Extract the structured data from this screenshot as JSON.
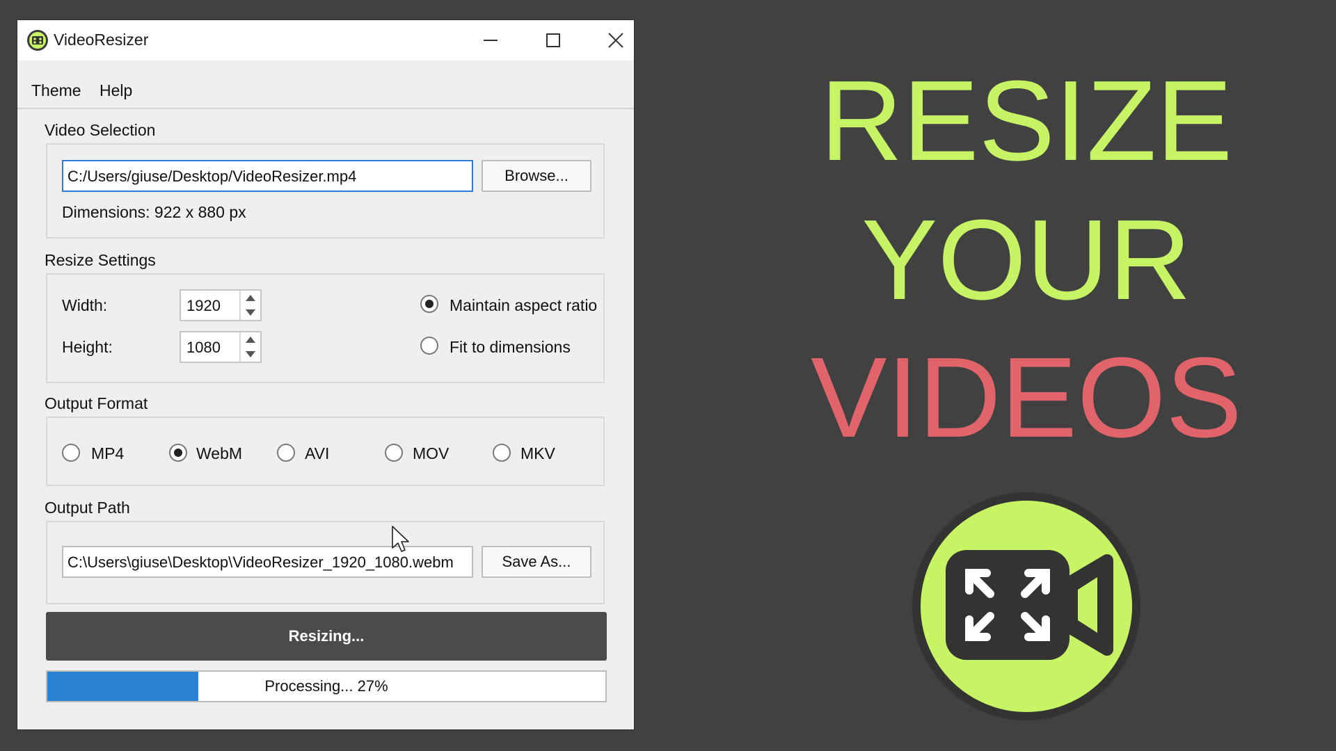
{
  "colors": {
    "background": "#414141",
    "accent_green": "#c7f464",
    "accent_red": "#e06469",
    "progress_blue": "#2a80d2",
    "resize_button": "#4b4b4b"
  },
  "window": {
    "title": "VideoResizer",
    "icon": "film-reel-icon",
    "controls": [
      "minimize-icon",
      "maximize-icon",
      "close-icon"
    ]
  },
  "menu": {
    "items": [
      "Theme",
      "Help"
    ]
  },
  "video_selection": {
    "label": "Video Selection",
    "path_value": "C:/Users/giuse/Desktop/VideoResizer.mp4",
    "browse_label": "Browse...",
    "dimensions": "Dimensions: 922 x 880 px"
  },
  "resize_settings": {
    "label": "Resize Settings",
    "width_label": "Width:",
    "width_value": "1920",
    "height_label": "Height:",
    "height_value": "1080",
    "options": [
      {
        "label": "Maintain aspect ratio",
        "selected": true
      },
      {
        "label": "Fit to dimensions",
        "selected": false
      }
    ]
  },
  "output_format": {
    "label": "Output Format",
    "options": [
      {
        "label": "MP4",
        "selected": false
      },
      {
        "label": "WebM",
        "selected": true
      },
      {
        "label": "AVI",
        "selected": false
      },
      {
        "label": "MOV",
        "selected": false
      },
      {
        "label": "MKV",
        "selected": false
      }
    ]
  },
  "output_path": {
    "label": "Output Path",
    "path_value": "C:\\Users\\giuse\\Desktop\\VideoResizer_1920_1080.webm",
    "save_label": "Save As..."
  },
  "action": {
    "resize_label": "Resizing..."
  },
  "progress": {
    "text": "Processing... 27%",
    "fraction": 0.27
  },
  "promo": {
    "line1": "RESIZE",
    "line2": "YOUR",
    "line3": "VIDEOS",
    "logo_icon": "video-camera-expand-icon"
  }
}
